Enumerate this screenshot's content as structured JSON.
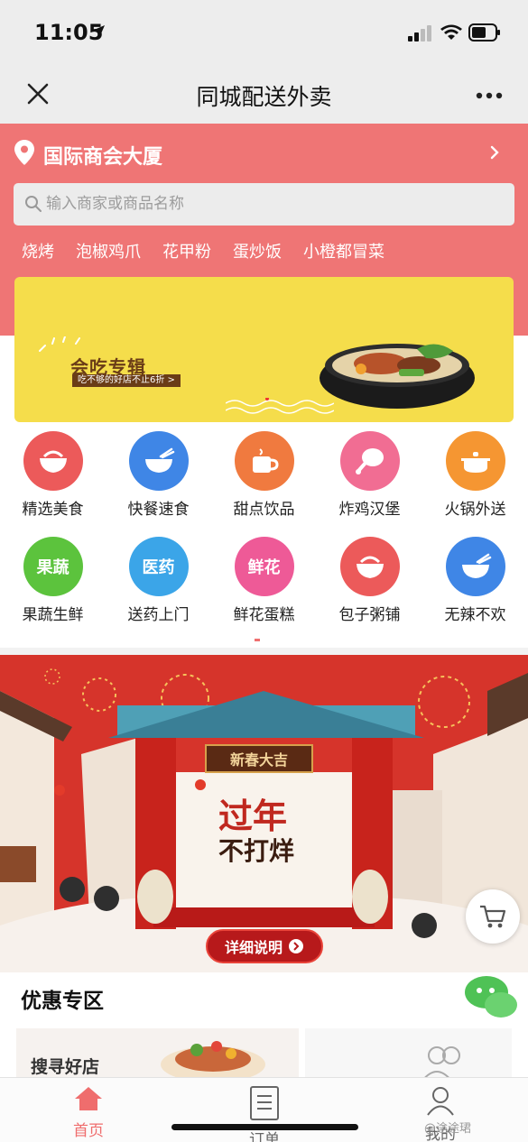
{
  "status_bar": {
    "time": "11:05"
  },
  "nav": {
    "title": "同城配送外卖"
  },
  "location": {
    "address": "国际商会大厦"
  },
  "search": {
    "placeholder": "输入商家或商品名称"
  },
  "hot_tags": [
    "烧烤",
    "泡椒鸡爪",
    "花甲粉",
    "蛋炒饭",
    "小橙都冒菜"
  ],
  "banner": {
    "title": "会吃专辑",
    "subtitle": "吃不够的好店不止6折  >"
  },
  "categories": [
    {
      "label": "精选美食",
      "icon": "rice-bowl-icon",
      "color": "#ec5a5a",
      "badge": ""
    },
    {
      "label": "快餐速食",
      "icon": "noodle-bowl-icon",
      "color": "#3f86e6",
      "badge": ""
    },
    {
      "label": "甜点饮品",
      "icon": "coffee-cup-icon",
      "color": "#f07a3f",
      "badge": ""
    },
    {
      "label": "炸鸡汉堡",
      "icon": "drumstick-icon",
      "color": "#f16d93",
      "badge": ""
    },
    {
      "label": "火锅外送",
      "icon": "hotpot-icon",
      "color": "#f59632",
      "badge": ""
    },
    {
      "label": "果蔬生鲜",
      "icon": "fruit-icon",
      "color": "#5cc33d",
      "badge": "果蔬"
    },
    {
      "label": "送药上门",
      "icon": "medicine-icon",
      "color": "#3ba5e8",
      "badge": "医药"
    },
    {
      "label": "鲜花蛋糕",
      "icon": "flower-icon",
      "color": "#ee5a97",
      "badge": "鲜花"
    },
    {
      "label": "包子粥铺",
      "icon": "rice-bowl-icon",
      "color": "#ec5a5a",
      "badge": ""
    },
    {
      "label": "无辣不欢",
      "icon": "noodle-bowl-icon",
      "color": "#3f86e6",
      "badge": ""
    }
  ],
  "festival": {
    "gate_title": "新春大吉",
    "slogan_line1": "过年",
    "slogan_line2": "不打烊",
    "detail_button": "详细说明"
  },
  "promo": {
    "title": "优惠专区",
    "card_text": "搜寻好店"
  },
  "tabbar": {
    "tabs": [
      {
        "label": "首页",
        "icon": "home-icon",
        "active": true
      },
      {
        "label": "订单",
        "icon": "order-icon",
        "active": false
      },
      {
        "label": "我的",
        "icon": "user-icon",
        "active": false
      }
    ]
  },
  "watermark": "@途途珺",
  "colors": {
    "brand": "#ef7575",
    "active_tab": "#ef6d6d"
  }
}
